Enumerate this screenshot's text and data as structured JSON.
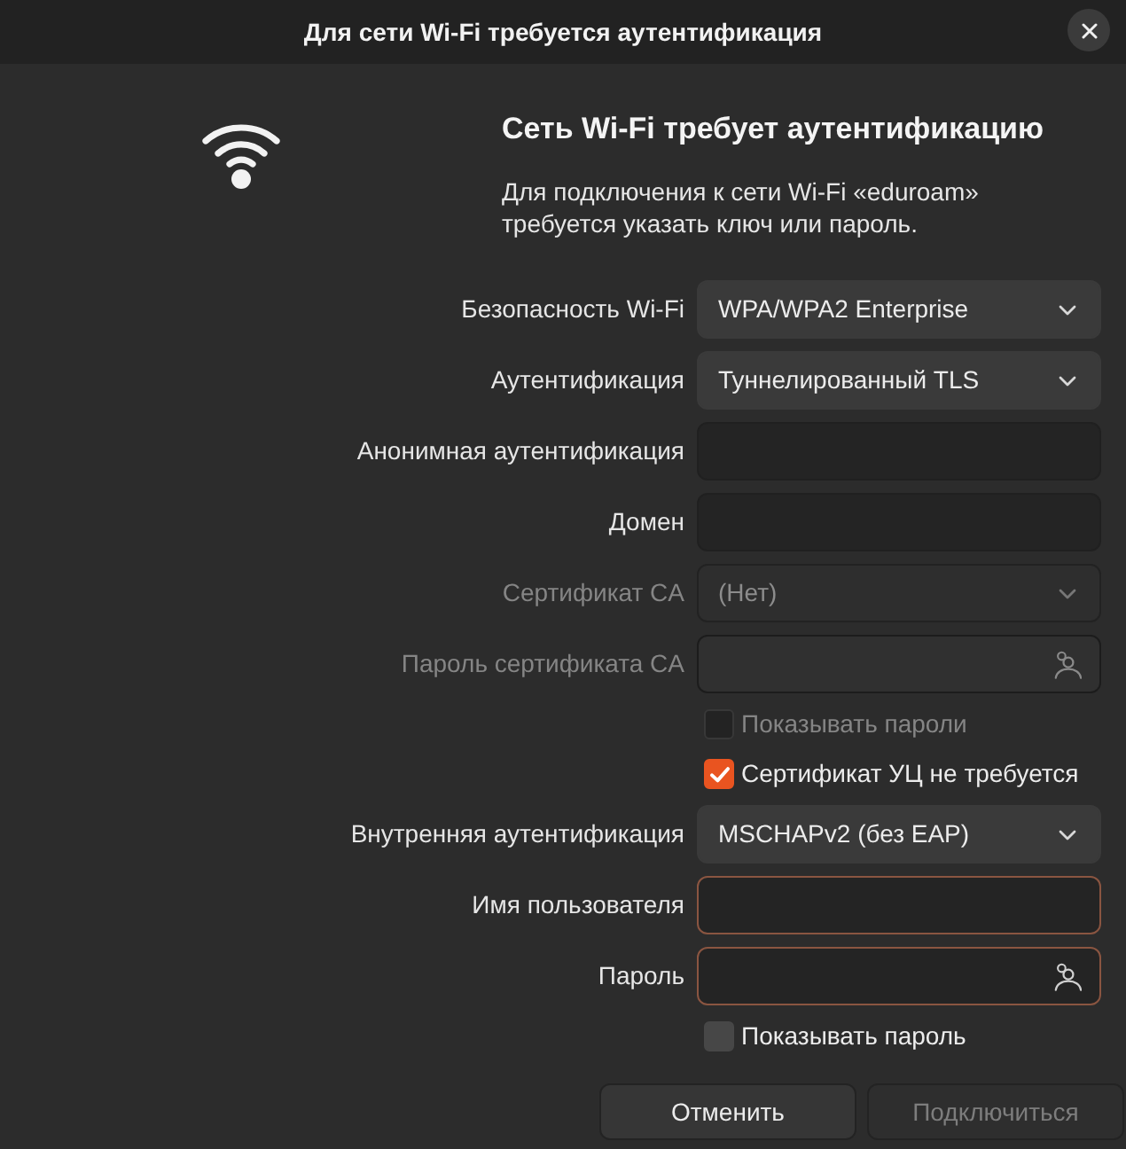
{
  "window": {
    "title": "Для сети Wi-Fi требуется аутентификация"
  },
  "header": {
    "heading": "Сеть Wi-Fi требует аутентификацию",
    "description": "Для подключения к сети Wi-Fi «eduroam» требуется указать ключ или пароль."
  },
  "form": [
    {
      "kind": "dropdown",
      "label": "Безопасность Wi-Fi",
      "value": "WPA/WPA2 Enterprise",
      "disabled": false
    },
    {
      "kind": "dropdown",
      "label": "Аутентификация",
      "value": "Туннелированный TLS",
      "disabled": false
    },
    {
      "kind": "text",
      "label": "Анонимная аутентификация",
      "disabled": false,
      "invalid": false
    },
    {
      "kind": "text",
      "label": "Домен",
      "disabled": false,
      "invalid": false
    },
    {
      "kind": "dropdown",
      "label": "Сертификат CA",
      "value": "(Нет)",
      "disabled": true
    },
    {
      "kind": "password",
      "label": "Пароль сертификата CA",
      "disabled": true,
      "invalid": false
    },
    {
      "kind": "checkbox",
      "label": "Показывать пароли",
      "checked": false,
      "disabled": true
    },
    {
      "kind": "checkbox",
      "label": "Сертификат УЦ не требуется",
      "checked": true,
      "disabled": false
    },
    {
      "kind": "dropdown",
      "label": "Внутренняя аутентификация",
      "value": "MSCHAPv2 (без EAP)",
      "disabled": false
    },
    {
      "kind": "text",
      "label": "Имя пользователя",
      "disabled": false,
      "invalid": true
    },
    {
      "kind": "password",
      "label": "Пароль",
      "disabled": false,
      "invalid": true
    },
    {
      "kind": "checkbox",
      "label": "Показывать пароль",
      "checked": false,
      "disabled": false
    }
  ],
  "buttons": [
    {
      "label": "Отменить",
      "disabled": false
    },
    {
      "label": "Подключиться",
      "disabled": true
    }
  ]
}
